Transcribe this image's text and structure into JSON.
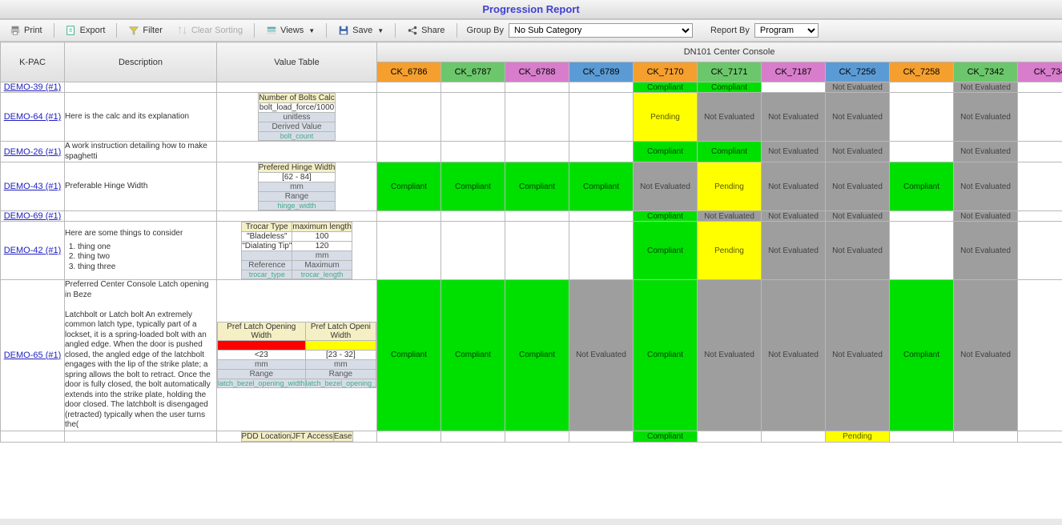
{
  "page": {
    "title": "Progression Report"
  },
  "toolbar": {
    "print": "Print",
    "export": "Export",
    "filter": "Filter",
    "clear_sorting": "Clear Sorting",
    "views": "Views",
    "save": "Save",
    "share": "Share",
    "group_by_label": "Group By",
    "group_by_value": "No Sub Category",
    "report_by_label": "Report By",
    "report_by_value": "Program"
  },
  "columns": {
    "kpac": "K-PAC",
    "description": "Description",
    "value_table": "Value Table",
    "group_header": "DN101 Center Console"
  },
  "ck_columns": [
    {
      "id": "CK_6786",
      "color": "#f59f2f"
    },
    {
      "id": "CK_6787",
      "color": "#6cc76c"
    },
    {
      "id": "CK_6788",
      "color": "#d77dcc"
    },
    {
      "id": "CK_6789",
      "color": "#5b9bd5"
    },
    {
      "id": "CK_7170",
      "color": "#f59f2f"
    },
    {
      "id": "CK_7171",
      "color": "#6cc76c"
    },
    {
      "id": "CK_7187",
      "color": "#d77dcc"
    },
    {
      "id": "CK_7256",
      "color": "#5b9bd5"
    },
    {
      "id": "CK_7258",
      "color": "#f59f2f"
    },
    {
      "id": "CK_7342",
      "color": "#6cc76c"
    },
    {
      "id": "CK_734",
      "color": "#d77dcc"
    }
  ],
  "rows": [
    {
      "kpac": "DEMO-39 (#1)",
      "status": [
        "",
        "",
        "",
        "",
        "Compliant",
        "Compliant",
        "",
        "Not Evaluated",
        "",
        "Not Evaluated",
        ""
      ]
    },
    {
      "kpac": "DEMO-64 (#1)",
      "desc": "Here is the calc and its explanation",
      "vt": {
        "type": "single",
        "title": "Number of Bolts Calc",
        "value": "bolt_load_force/1000",
        "unit": "unitless",
        "kind": "Derived Value",
        "var": "bolt_count"
      },
      "status": [
        "",
        "",
        "",
        "",
        "Pending",
        "Not Evaluated",
        "Not Evaluated",
        "Not Evaluated",
        "",
        "Not Evaluated",
        ""
      ]
    },
    {
      "kpac": "DEMO-26 (#1)",
      "desc": "A work instruction detailing how to make spaghetti",
      "status": [
        "",
        "",
        "",
        "",
        "Compliant",
        "Compliant",
        "Not Evaluated",
        "Not Evaluated",
        "",
        "Not Evaluated",
        ""
      ]
    },
    {
      "kpac": "DEMO-43 (#1)",
      "desc": "Preferable Hinge Width",
      "vt": {
        "type": "single",
        "title": "Prefered Hinge Width",
        "value": "[62 - 84]",
        "unit": "mm",
        "kind": "Range",
        "var": "hinge_width"
      },
      "status": [
        "Compliant",
        "Compliant",
        "Compliant",
        "Compliant",
        "Not Evaluated",
        "Pending",
        "Not Evaluated",
        "Not Evaluated",
        "Compliant",
        "Not Evaluated",
        ""
      ]
    },
    {
      "kpac": "DEMO-69 (#1)",
      "status": [
        "",
        "",
        "",
        "",
        "Compliant",
        "Not Evaluated",
        "Not Evaluated",
        "Not Evaluated",
        "",
        "Not Evaluated",
        ""
      ]
    },
    {
      "kpac": "DEMO-42 (#1)",
      "desc_html": "Here are some things to consider<ol><li>thing one</li><li>thing two</li><li>thing three</li></ol>",
      "vt": {
        "type": "double",
        "heads": [
          "Trocar Type",
          "maximum length"
        ],
        "rows": [
          [
            "\"Bladeless\"",
            "100"
          ],
          [
            "\"Dialating Tip\"",
            "120"
          ]
        ],
        "units": [
          "",
          "mm"
        ],
        "kinds": [
          "Reference",
          "Maximum"
        ],
        "vars": [
          "trocar_type",
          "trocar_length"
        ]
      },
      "status": [
        "",
        "",
        "",
        "",
        "Compliant",
        "Pending",
        "Not Evaluated",
        "Not Evaluated",
        "",
        "Not Evaluated",
        ""
      ]
    },
    {
      "kpac": "DEMO-65 (#1)",
      "desc": "Preferred Center Console Latch opening in Beze\n\nLatchbolt or Latch bolt An extremely common latch type, typically part of a lockset, it is a spring-loaded bolt with an angled edge. When the door is pushed closed, the angled edge of the latchbolt engages with the lip of the strike plate; a spring allows the bolt to retract. Once the door is fully closed, the bolt automatically extends into the strike plate, holding the door closed. The latchbolt is disengaged (retracted) typically when the user turns the(",
      "vt": {
        "type": "double_color",
        "heads": [
          "Pref Latch Opening Width",
          "Pref Latch Openi Width"
        ],
        "colorrow": [
          "red",
          "yel"
        ],
        "rows": [
          [
            "<23",
            "[23 - 32]"
          ]
        ],
        "units": [
          "mm",
          "mm"
        ],
        "kinds": [
          "Range",
          "Range"
        ],
        "vars": [
          "latch_bezel_opening_width",
          "latch_bezel_opening_"
        ]
      },
      "status": [
        "Compliant",
        "Compliant",
        "Compliant",
        "Not Evaluated",
        "Compliant",
        "Not Evaluated",
        "Not Evaluated",
        "Not Evaluated",
        "Compliant",
        "Not Evaluated",
        ""
      ]
    },
    {
      "kpac": "",
      "vt": {
        "type": "headonly",
        "heads": [
          "PDD Location",
          "JFT Access",
          "Ease"
        ]
      },
      "status": [
        "",
        "",
        "",
        "",
        "Compliant",
        "",
        "",
        "Pending",
        "",
        "",
        ""
      ]
    }
  ]
}
